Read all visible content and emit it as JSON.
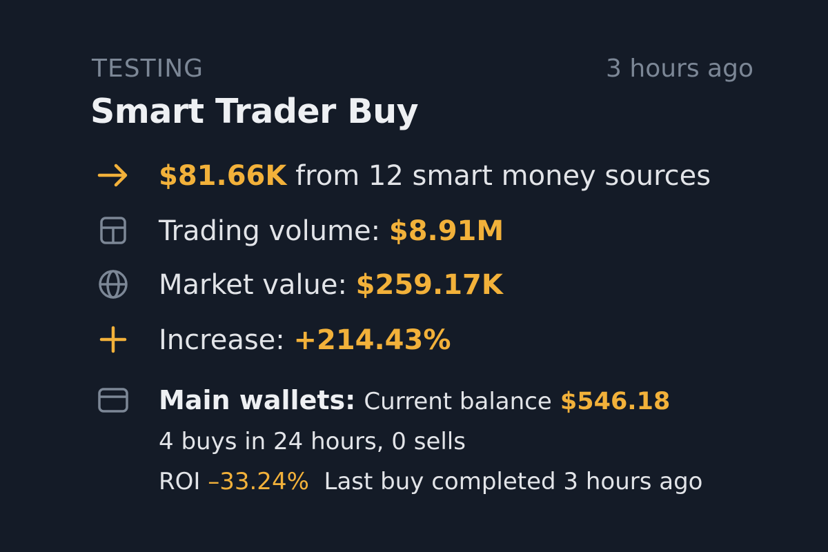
{
  "header": {
    "category": "TESTING",
    "timestamp": "3 hours ago",
    "title": "Smart Trader Buy"
  },
  "rows": {
    "sources": {
      "icon": "arrow-right-icon",
      "amount": "$81.66K",
      "text": " from 12 smart money sources"
    },
    "volume": {
      "icon": "layout-panel-icon",
      "label": "Trading volume: ",
      "value": "$8.91M"
    },
    "market": {
      "icon": "globe-icon",
      "label": "Market value: ",
      "value": "$259.17K"
    },
    "increase": {
      "icon": "plus-icon",
      "label": "Increase: ",
      "value": "+214.43%"
    }
  },
  "wallets": {
    "icon": "credit-card-icon",
    "label": "Main wallets:",
    "balance_label": "Current balance",
    "balance_value": "$546.18",
    "activity": "4 buys in 24 hours, 0 sells",
    "roi_label": "ROI",
    "roi_value": "–33.24%",
    "last_buy": "Last buy completed 3 hours ago"
  },
  "colors": {
    "background": "#141b27",
    "accent": "#f2b13a",
    "muted": "#7c8796",
    "text": "#e2e4e8"
  }
}
